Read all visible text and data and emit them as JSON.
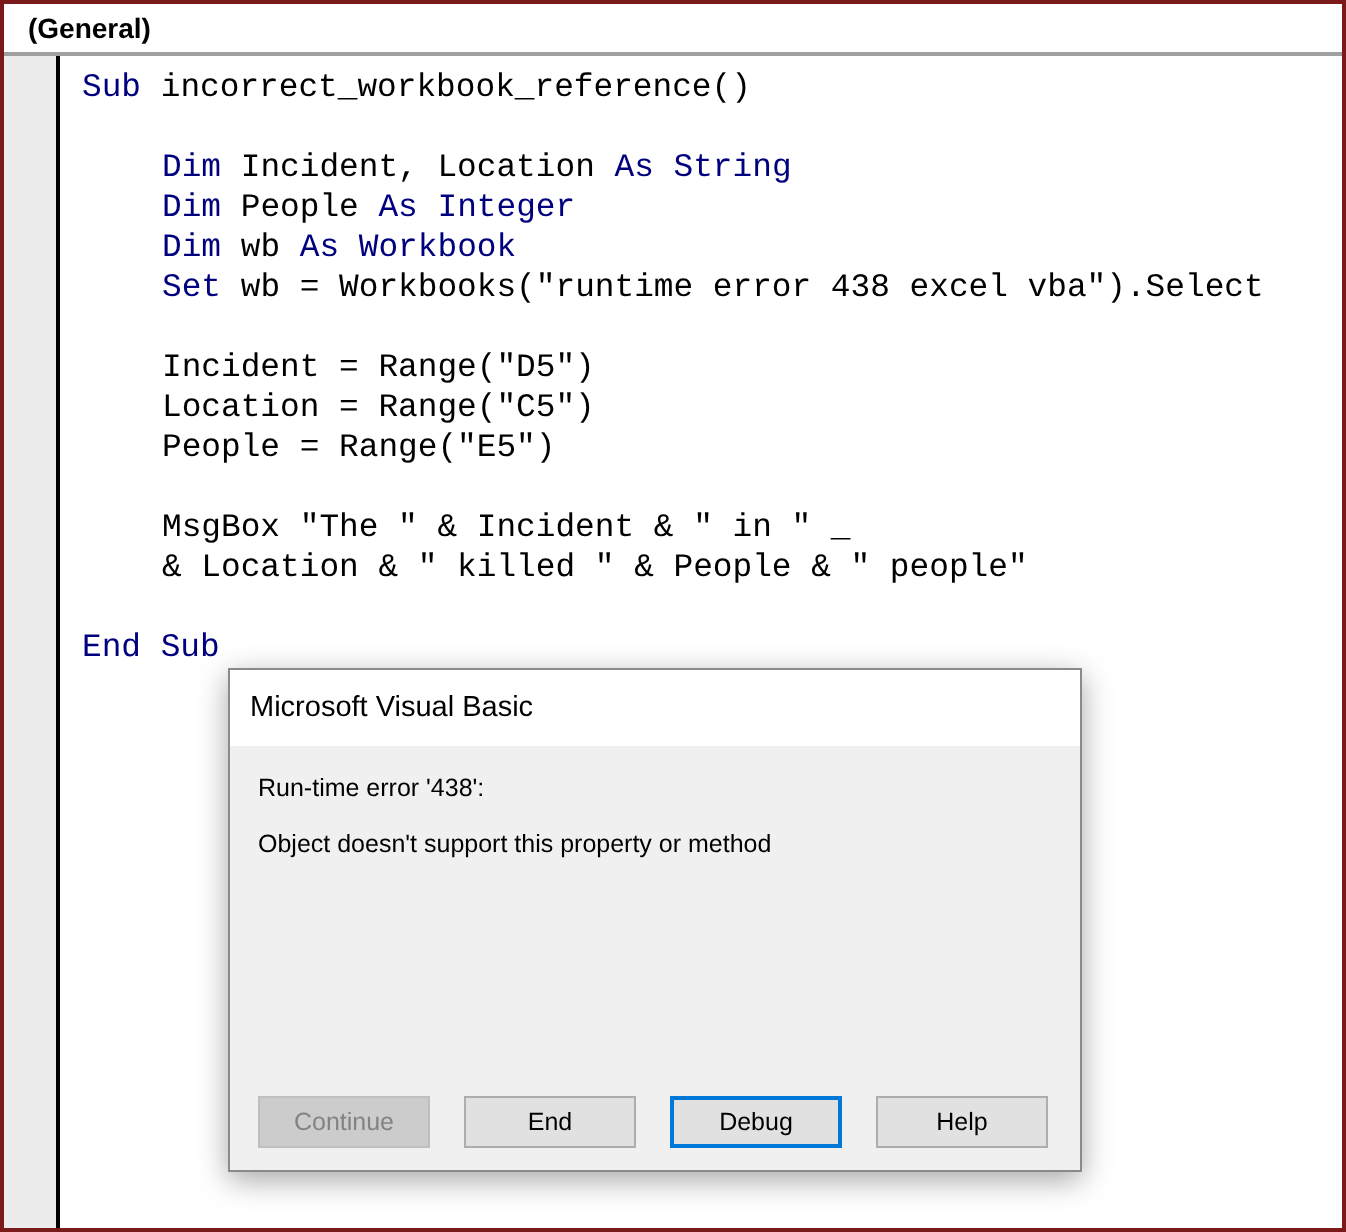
{
  "object_box": {
    "label": "(General)"
  },
  "code_lines": [
    {
      "kind": "code",
      "indented": false,
      "tokens": [
        {
          "text": "Sub",
          "keyword": true
        },
        {
          "text": " incorrect_workbook_reference()",
          "keyword": false
        }
      ]
    },
    {
      "kind": "blank"
    },
    {
      "kind": "code",
      "indented": true,
      "tokens": [
        {
          "text": "Dim",
          "keyword": true
        },
        {
          "text": " Incident, Location ",
          "keyword": false
        },
        {
          "text": "As String",
          "keyword": true
        }
      ]
    },
    {
      "kind": "code",
      "indented": true,
      "tokens": [
        {
          "text": "Dim",
          "keyword": true
        },
        {
          "text": " People ",
          "keyword": false
        },
        {
          "text": "As Integer",
          "keyword": true
        }
      ]
    },
    {
      "kind": "code",
      "indented": true,
      "tokens": [
        {
          "text": "Dim",
          "keyword": true
        },
        {
          "text": " wb ",
          "keyword": false
        },
        {
          "text": "As Workbook",
          "keyword": true
        }
      ]
    },
    {
      "kind": "code",
      "indented": true,
      "tokens": [
        {
          "text": "Set",
          "keyword": true
        },
        {
          "text": " wb = Workbooks(\"runtime error 438 excel vba\").Select",
          "keyword": false
        }
      ]
    },
    {
      "kind": "blank"
    },
    {
      "kind": "code",
      "indented": true,
      "tokens": [
        {
          "text": "Incident = Range(\"D5\")",
          "keyword": false
        }
      ]
    },
    {
      "kind": "code",
      "indented": true,
      "tokens": [
        {
          "text": "Location = Range(\"C5\")",
          "keyword": false
        }
      ]
    },
    {
      "kind": "code",
      "indented": true,
      "tokens": [
        {
          "text": "People = Range(\"E5\")",
          "keyword": false
        }
      ]
    },
    {
      "kind": "blank"
    },
    {
      "kind": "code",
      "indented": true,
      "tokens": [
        {
          "text": "MsgBox \"The \" & Incident & \" in \" _",
          "keyword": false
        }
      ]
    },
    {
      "kind": "code",
      "indented": true,
      "tokens": [
        {
          "text": "& Location & \" killed \" & People & \" people\"",
          "keyword": false
        }
      ]
    },
    {
      "kind": "blank"
    },
    {
      "kind": "code",
      "indented": false,
      "tokens": [
        {
          "text": "End Sub",
          "keyword": true
        }
      ]
    }
  ],
  "dialog": {
    "title": "Microsoft Visual Basic",
    "error": "Run-time error '438':",
    "message": "Object doesn't support this property or method",
    "buttons": [
      {
        "label": "Continue",
        "disabled": true,
        "focused": false
      },
      {
        "label": "End",
        "disabled": false,
        "focused": false
      },
      {
        "label": "Debug",
        "disabled": false,
        "focused": true
      },
      {
        "label": "Help",
        "disabled": false,
        "focused": false
      }
    ]
  }
}
